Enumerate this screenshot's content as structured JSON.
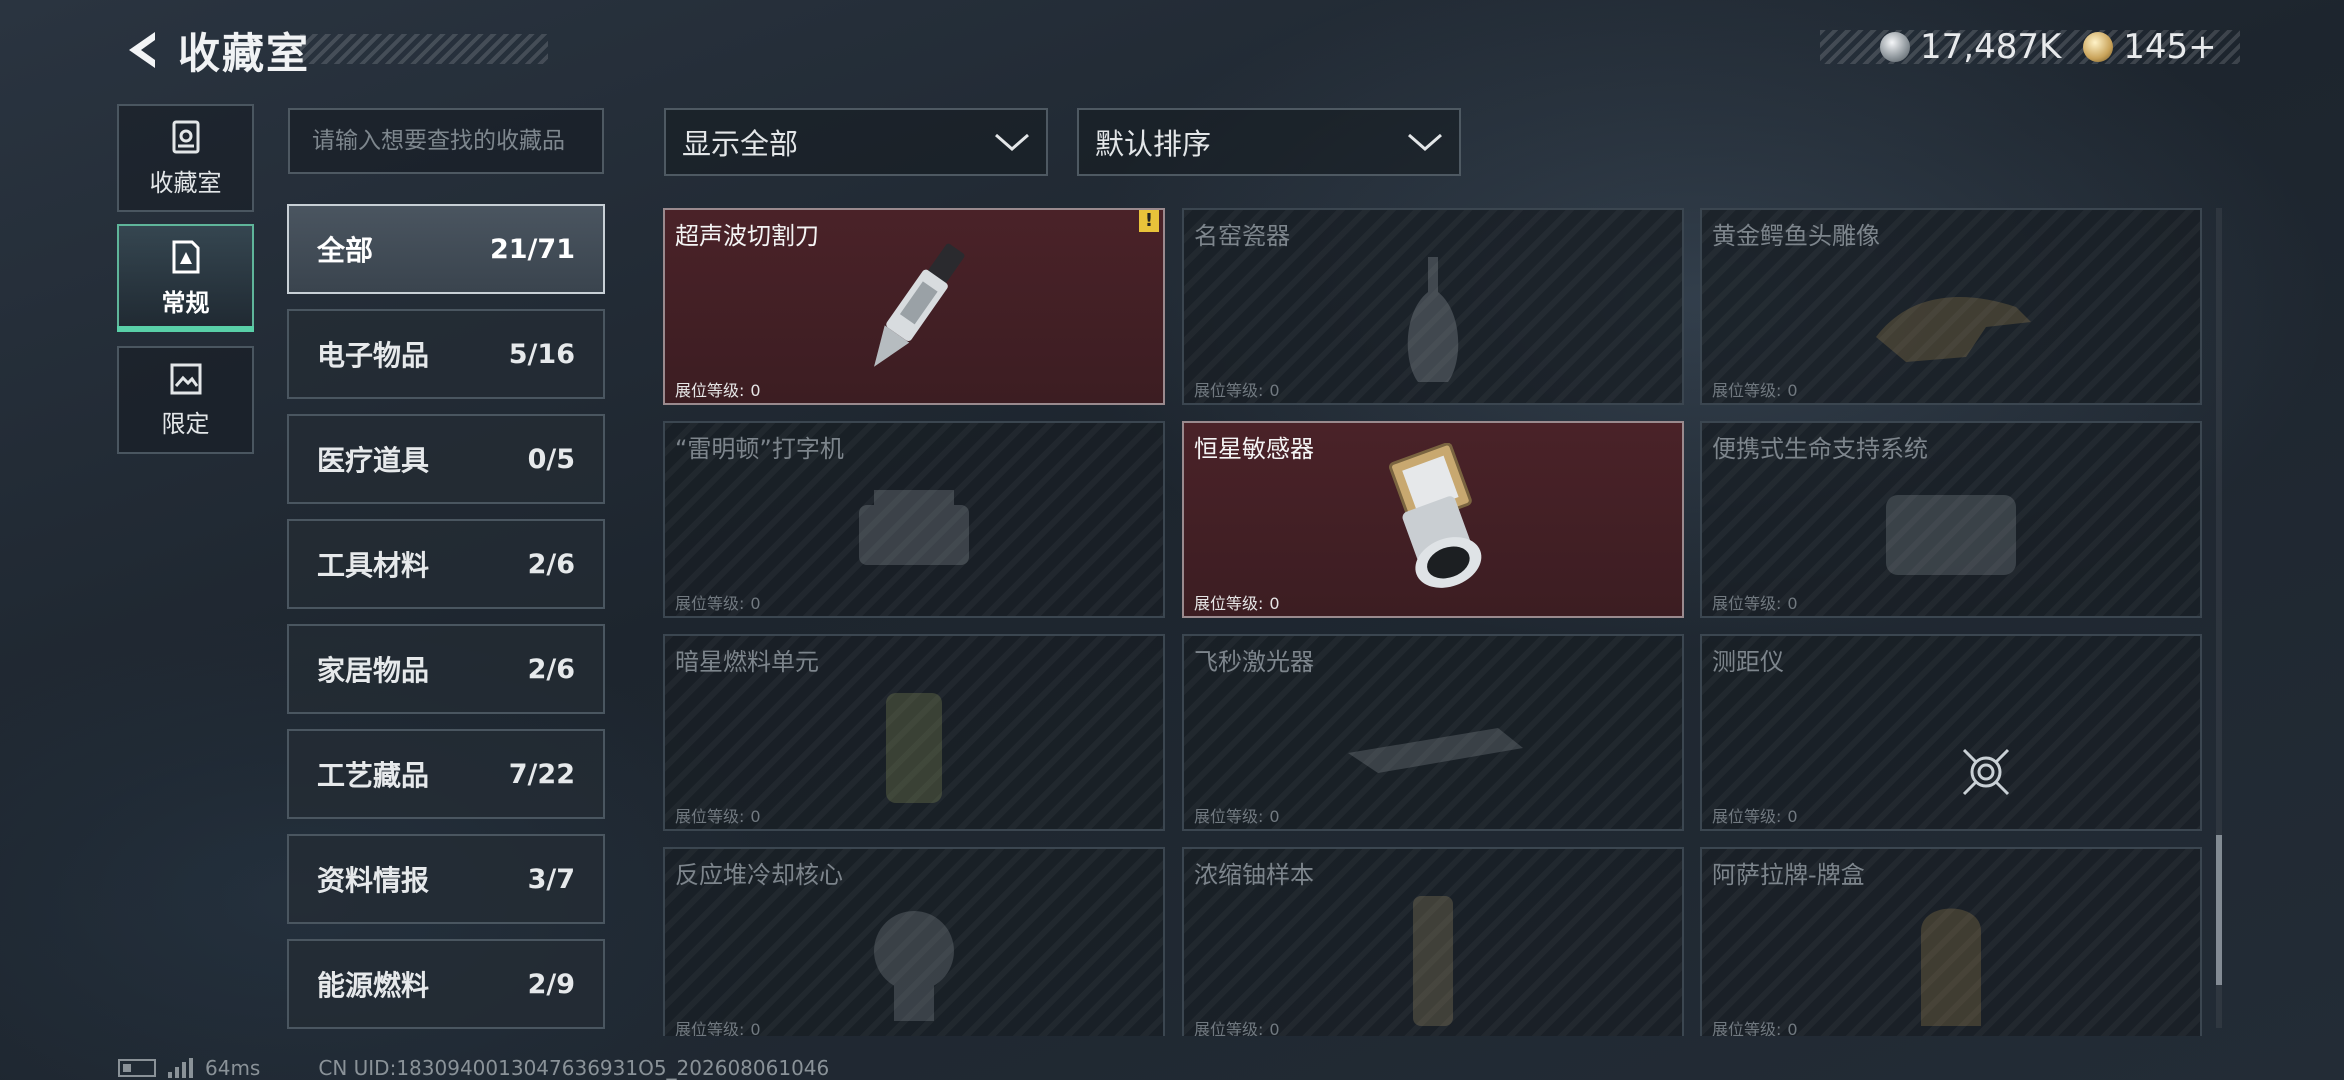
{
  "header": {
    "title": "收藏室"
  },
  "currencies": [
    {
      "icon": "silver-coin-icon",
      "value": "17,487K"
    },
    {
      "icon": "gold-coin-icon",
      "value": "145+"
    }
  ],
  "modes": [
    {
      "label": "收藏室",
      "icon": "collection-box-icon",
      "active": false
    },
    {
      "label": "常规",
      "icon": "document-icon",
      "active": true
    },
    {
      "label": "限定",
      "icon": "picture-icon",
      "active": false
    }
  ],
  "search": {
    "placeholder": "请输入想要查找的收藏品"
  },
  "categories": [
    {
      "name": "全部",
      "count": "21/71",
      "active": true
    },
    {
      "name": "电子物品",
      "count": "5/16"
    },
    {
      "name": "医疗道具",
      "count": "0/5"
    },
    {
      "name": "工具材料",
      "count": "2/6"
    },
    {
      "name": "家居物品",
      "count": "2/6"
    },
    {
      "name": "工艺藏品",
      "count": "7/22"
    },
    {
      "name": "资料情报",
      "count": "3/7"
    },
    {
      "name": "能源燃料",
      "count": "2/9"
    }
  ],
  "filters": {
    "display": "显示全部",
    "sort": "默认排序"
  },
  "level_label": "展位等级:",
  "items": [
    {
      "name": "超声波切割刀",
      "level": "0",
      "owned": true,
      "alert": "!"
    },
    {
      "name": "名窑瓷器",
      "level": "0",
      "owned": false
    },
    {
      "name": "黄金鳄鱼头雕像",
      "level": "0",
      "owned": false
    },
    {
      "name": "“雷明顿”打字机",
      "level": "0",
      "owned": false
    },
    {
      "name": "恒星敏感器",
      "level": "0",
      "owned": true
    },
    {
      "name": "便携式生命支持系统",
      "level": "0",
      "owned": false
    },
    {
      "name": "暗星燃料单元",
      "level": "0",
      "owned": false
    },
    {
      "name": "飞秒激光器",
      "level": "0",
      "owned": false
    },
    {
      "name": "测距仪",
      "level": "0",
      "owned": false
    },
    {
      "name": "反应堆冷却核心",
      "level": "0",
      "owned": false
    },
    {
      "name": "浓缩铀样本",
      "level": "0",
      "owned": false
    },
    {
      "name": "阿萨拉牌-牌盒",
      "level": "0",
      "owned": false
    }
  ],
  "footer": {
    "ping": "64ms",
    "uid": "CN UID:1830940013047636931O5_202608061046"
  }
}
